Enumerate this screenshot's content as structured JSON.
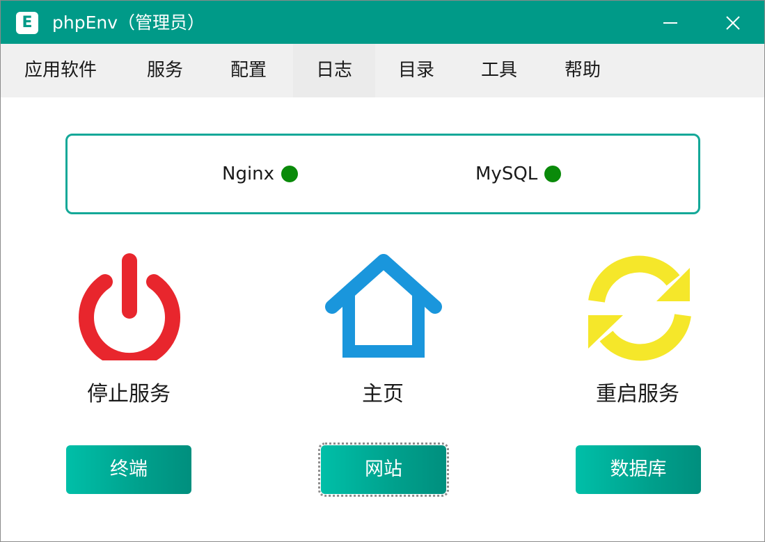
{
  "window": {
    "title": "phpEnv（管理员）",
    "logo_letter": "E"
  },
  "menu": {
    "items": [
      {
        "label": "应用软件"
      },
      {
        "label": "服务"
      },
      {
        "label": "配置"
      },
      {
        "label": "日志"
      },
      {
        "label": "目录"
      },
      {
        "label": "工具"
      },
      {
        "label": "帮助"
      }
    ]
  },
  "status": {
    "services": [
      {
        "name": "Nginx",
        "state_color": "#0a8a0a"
      },
      {
        "name": "MySQL",
        "state_color": "#0a8a0a"
      }
    ]
  },
  "actions": {
    "stop": {
      "label": "停止服务",
      "icon": "power-icon",
      "color": "#e8262d"
    },
    "home": {
      "label": "主页",
      "icon": "home-icon",
      "color": "#1a96dc"
    },
    "restart": {
      "label": "重启服务",
      "icon": "refresh-icon",
      "color": "#f5e72a"
    }
  },
  "buttons": {
    "terminal": "终端",
    "website": "网站",
    "database": "数据库"
  },
  "colors": {
    "accent": "#009a88",
    "menubar": "#f0f0f0",
    "button_gradient_start": "#00bfa8",
    "button_gradient_end": "#008f7e"
  }
}
